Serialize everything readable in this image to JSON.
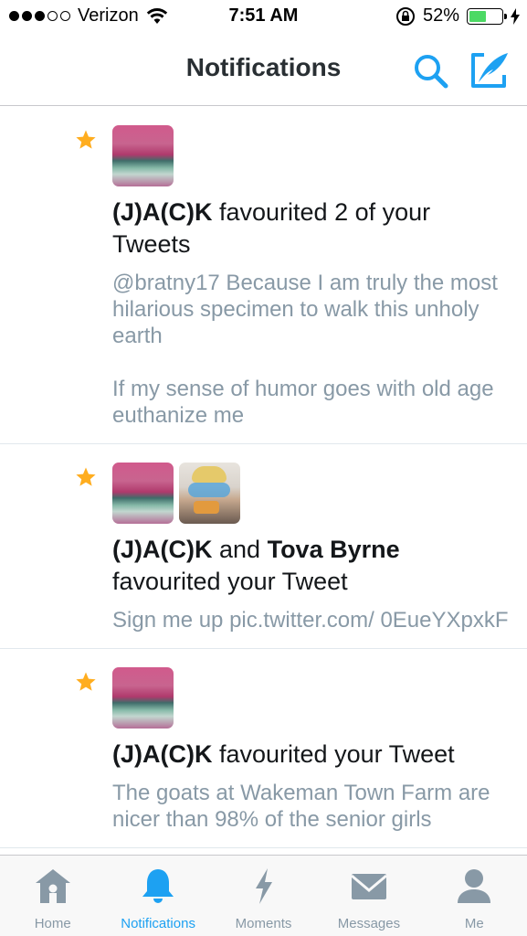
{
  "status_bar": {
    "carrier": "Verizon",
    "time": "7:51 AM",
    "battery_percent": "52%",
    "battery_level": 0.52,
    "icons": [
      "signal-dots-icon",
      "wifi-icon",
      "rotation-lock-icon",
      "battery-icon",
      "charging-icon"
    ]
  },
  "nav": {
    "title": "Notifications",
    "icons": [
      "search-icon",
      "compose-tweet-icon"
    ]
  },
  "notifications": [
    {
      "icon": "star-icon",
      "avatars": [
        "jack-avatar"
      ],
      "user1": "(J)A(C)K",
      "joiner": "",
      "user2": "",
      "action": "favourited 2 of your Tweets",
      "tweets": [
        "@bratny17 Because I am truly the most hilarious specimen to walk this unholy earth",
        "If my sense of humor goes with old age euthanize me"
      ]
    },
    {
      "icon": "star-icon",
      "avatars": [
        "jack-avatar",
        "tova-byrne-avatar"
      ],
      "user1": "(J)A(C)K",
      "joiner": "and",
      "user2": "Tova Byrne",
      "action": "favourited your Tweet",
      "tweets": [
        "Sign me up pic.twitter.com/ 0EueYXpxkF"
      ]
    },
    {
      "icon": "star-icon",
      "avatars": [
        "jack-avatar"
      ],
      "user1": "(J)A(C)K",
      "joiner": "",
      "user2": "",
      "action": "favourited your Tweet",
      "tweets": [
        "The goats at Wakeman Town Farm are nicer than 98% of the senior girls"
      ]
    }
  ],
  "tab_bar": {
    "tabs": [
      {
        "label": "Home",
        "icon": "home-icon",
        "active": false
      },
      {
        "label": "Notifications",
        "icon": "bell-icon",
        "active": true
      },
      {
        "label": "Moments",
        "icon": "lightning-icon",
        "active": false
      },
      {
        "label": "Messages",
        "icon": "envelope-icon",
        "active": false
      },
      {
        "label": "Me",
        "icon": "person-icon",
        "active": false
      }
    ]
  },
  "colors": {
    "accent": "#1da1f2",
    "star": "#ffad1f",
    "secondary_text": "#8899a6",
    "inactive_icon": "#8899a6",
    "battery_fill": "#4cd964"
  }
}
